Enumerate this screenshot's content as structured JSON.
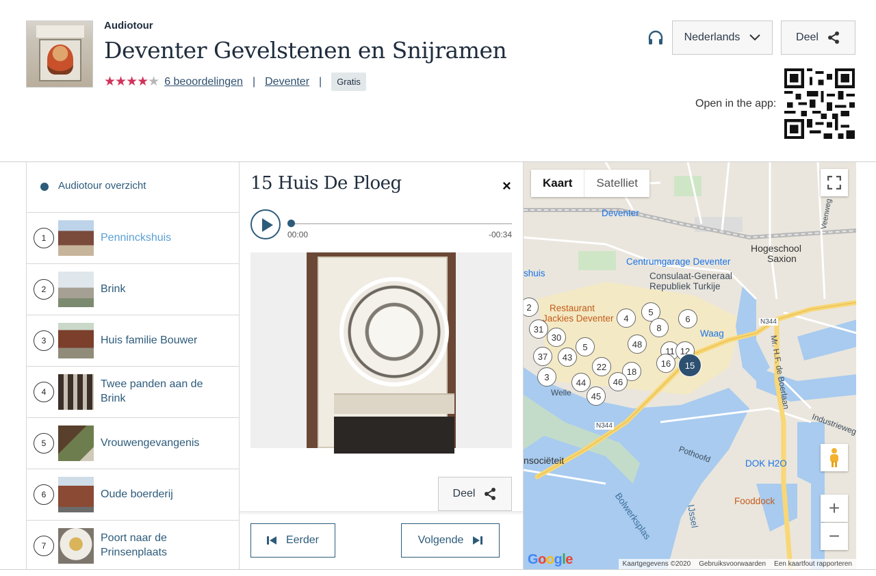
{
  "header": {
    "kicker": "Audiotour",
    "title": "Deventer Gevelstenen en Snijramen",
    "rating": {
      "stars": 4,
      "max": 5,
      "reviews_label": "6 beoordelingen"
    },
    "location_link": "Deventer",
    "separator": "|",
    "price_badge": "Gratis",
    "language_label": "Nederlands",
    "share_label": "Deel",
    "open_app_label": "Open in the app:"
  },
  "tour_list": {
    "overview_label": "Audiotour overzicht",
    "stops": [
      {
        "number": "1",
        "name": "Penninckshuis",
        "active": true
      },
      {
        "number": "2",
        "name": "Brink"
      },
      {
        "number": "3",
        "name": "Huis familie Bouwer"
      },
      {
        "number": "4",
        "name": "Twee panden aan de Brink"
      },
      {
        "number": "5",
        "name": "Vrouwengevangenis"
      },
      {
        "number": "6",
        "name": "Oude boerderij"
      },
      {
        "number": "7",
        "name": "Poort naar de Prinsenplaats"
      }
    ]
  },
  "detail": {
    "title": "15 Huis De Ploeg",
    "close_symbol": "×",
    "player": {
      "elapsed": "00:00",
      "remaining": "-00:34",
      "progress": 0
    },
    "share_label": "Deel",
    "prev_label": "Eerder",
    "next_label": "Volgende"
  },
  "map": {
    "tabs": [
      "Kaart",
      "Satelliet"
    ],
    "labels": {
      "deventer": "Deventer",
      "hogeschool": "Hogeschool",
      "saxion": "Saxion",
      "centrumgarage": "Centrumgarage Deventer",
      "consulaat1": "Consulaat-Generaal",
      "consulaat2": "Republiek Turkije",
      "restaurant1": "Restaurant",
      "restaurant2": "Jackies Deventer",
      "waag": "Waag",
      "dok": "DOK H2O",
      "fooddock": "Fooddock",
      "n344a": "N344",
      "n344b": "N344",
      "societeit": "nsociëteit",
      "huis": "shuis",
      "bolwerksplas": "Bolwerksplas",
      "ijssel": "IJssel",
      "welle": "Welle",
      "pothoofd": "Pothoofd",
      "industrieweg": "Industrieweg",
      "mr_hf": "Mr. H.F. de Boerlaan",
      "veenweg": "Veenweg"
    },
    "pins": [
      "2",
      "4",
      "5",
      "6",
      "8",
      "31",
      "30",
      "48",
      "5",
      "11",
      "12",
      "37",
      "43",
      "22",
      "16",
      "18",
      "3",
      "44",
      "46",
      "45",
      "15"
    ],
    "active_pin": "15",
    "google_label": "Google",
    "attribution": [
      "Kaartgegevens ©2020",
      "Gebruiksvoorwaarden",
      "Een kaartfout rapporteren"
    ],
    "zoom_in": "+",
    "zoom_out": "−",
    "colors": {
      "water": "#a8cbef",
      "roads": "#f8d776",
      "active_pin": "#2d5070"
    }
  },
  "colors": {
    "accent": "#2d5b7a",
    "stars": "#d0335a",
    "active_stop": "#5b9fd4"
  }
}
